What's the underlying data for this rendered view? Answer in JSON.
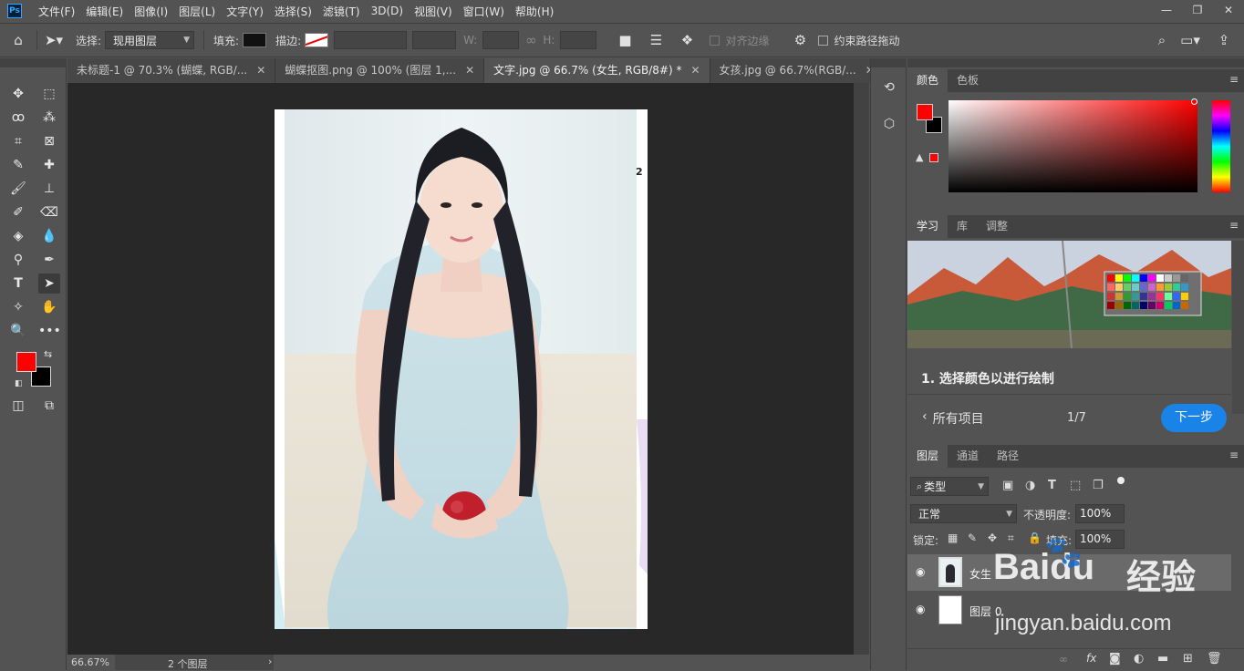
{
  "app": {
    "logo": "Ps"
  },
  "menu": [
    "文件(F)",
    "编辑(E)",
    "图像(I)",
    "图层(L)",
    "文字(Y)",
    "选择(S)",
    "滤镜(T)",
    "3D(D)",
    "视图(V)",
    "窗口(W)",
    "帮助(H)"
  ],
  "window_controls": {
    "minimize": "—",
    "restore": "❐",
    "close": "✕"
  },
  "options": {
    "select_label": "选择:",
    "select_value": "现用图层",
    "fill_label": "填充:",
    "stroke_label": "描边:",
    "w_label": "W:",
    "h_label": "H:",
    "align_edges": "对齐边缘",
    "constrain_path": "约束路径拖动"
  },
  "tabs": [
    {
      "label": "未标题-1 @ 70.3% (蝴蝶, RGB/..."
    },
    {
      "label": "蝴蝶抠图.png @ 100% (图层 1,..."
    },
    {
      "label": "文字.jpg @ 66.7% (女生, RGB/8#) *"
    },
    {
      "label": "女孩.jpg @ 66.7%(RGB/..."
    }
  ],
  "close_glyph": "✕",
  "doc": {
    "edge_mark": "2"
  },
  "status": {
    "zoom": "66.67%",
    "info": "2 个图层",
    "arrow": "›"
  },
  "color_panel": {
    "tabs": [
      "颜色",
      "色板"
    ],
    "foreground": "#ff0000",
    "background": "#000000"
  },
  "learn_panel": {
    "tabs": [
      "学习",
      "库",
      "调整"
    ],
    "step_title": "1. 选择颜色以进行绘制",
    "all_items": "所有项目",
    "progress": "1/7",
    "next_button": "下一步"
  },
  "layers_panel": {
    "tabs": [
      "图层",
      "通道",
      "路径"
    ],
    "filter_kind": "类型",
    "blend_mode": "正常",
    "opacity_label": "不透明度:",
    "opacity_value": "100%",
    "lock_label": "锁定:",
    "fill_label": "填充:",
    "fill_value": "100%",
    "layers": [
      {
        "name": "女生"
      },
      {
        "name": "图层 0"
      }
    ],
    "bottom_icons": [
      "link-icon",
      "fx-icon",
      "mask-icon",
      "adjustment-icon",
      "group-icon",
      "new-layer-icon",
      "trash-icon"
    ],
    "fx_label": "fx"
  },
  "watermark": {
    "brand": "Baidu",
    "product": "经验",
    "url": "jingyan.baidu.com"
  }
}
